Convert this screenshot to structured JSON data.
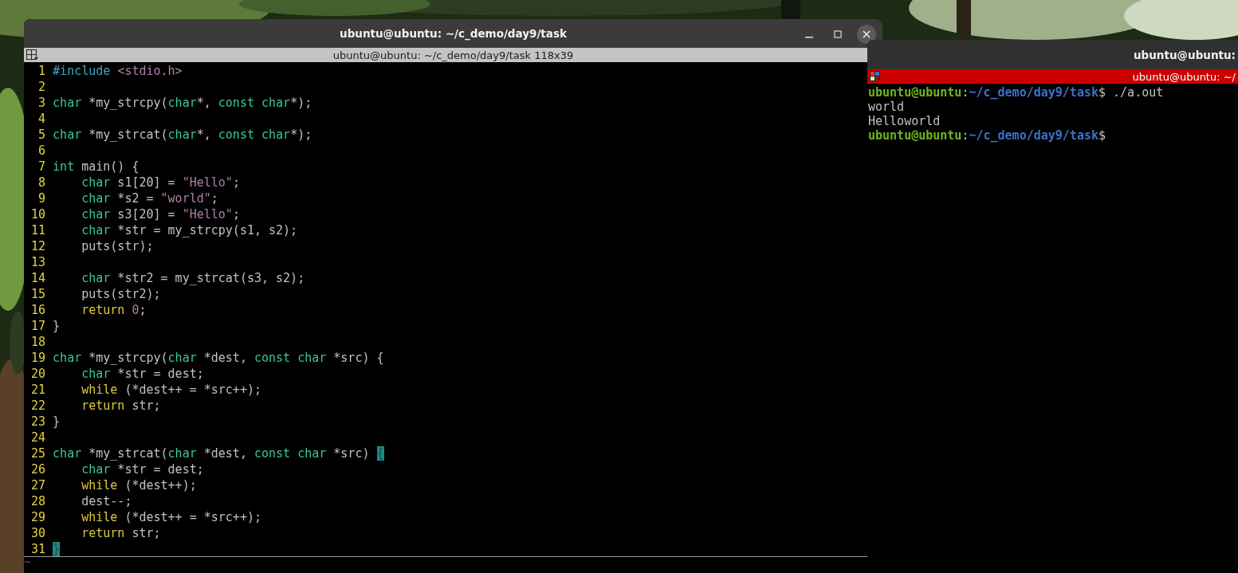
{
  "editor_window": {
    "title": "ubuntu@ubuntu: ~/c_demo/day9/task",
    "tab_title": "ubuntu@ubuntu: ~/c_demo/day9/task 118x39",
    "lines": [
      {
        "number": "1",
        "current": false,
        "tokens": [
          {
            "kind": "preproc",
            "text": "#include "
          },
          {
            "kind": "string",
            "text": "<stdio.h>"
          }
        ]
      },
      {
        "number": "2",
        "current": false
      },
      {
        "number": "3",
        "current": false,
        "tokens": [
          {
            "kind": "type",
            "text": "char"
          },
          {
            "kind": "plain",
            "text": " *my_strcpy("
          },
          {
            "kind": "type",
            "text": "char"
          },
          {
            "kind": "plain",
            "text": "*, "
          },
          {
            "kind": "type",
            "text": "const char"
          },
          {
            "kind": "plain",
            "text": "*);"
          }
        ]
      },
      {
        "number": "4",
        "current": false
      },
      {
        "number": "5",
        "current": false,
        "tokens": [
          {
            "kind": "type",
            "text": "char"
          },
          {
            "kind": "plain",
            "text": " *my_strcat("
          },
          {
            "kind": "type",
            "text": "char"
          },
          {
            "kind": "plain",
            "text": "*, "
          },
          {
            "kind": "type",
            "text": "const char"
          },
          {
            "kind": "plain",
            "text": "*);"
          }
        ]
      },
      {
        "number": "6",
        "current": false
      },
      {
        "number": "7",
        "current": false,
        "tokens": [
          {
            "kind": "type",
            "text": "int"
          },
          {
            "kind": "plain",
            "text": " main() {"
          }
        ]
      },
      {
        "number": "8",
        "current": false,
        "tokens": [
          {
            "kind": "type",
            "text": "    char"
          },
          {
            "kind": "plain",
            "text": " s1[20] = "
          },
          {
            "kind": "string",
            "text": "\"Hello\""
          },
          {
            "kind": "plain",
            "text": ";"
          }
        ]
      },
      {
        "number": "9",
        "current": false,
        "tokens": [
          {
            "kind": "type",
            "text": "    char"
          },
          {
            "kind": "plain",
            "text": " *s2 = "
          },
          {
            "kind": "string",
            "text": "\"world\""
          },
          {
            "kind": "plain",
            "text": ";"
          }
        ]
      },
      {
        "number": "10",
        "current": false,
        "tokens": [
          {
            "kind": "type",
            "text": "    char"
          },
          {
            "kind": "plain",
            "text": " s3[20] = "
          },
          {
            "kind": "string",
            "text": "\"Hello\""
          },
          {
            "kind": "plain",
            "text": ";"
          }
        ]
      },
      {
        "number": "11",
        "current": false,
        "tokens": [
          {
            "kind": "type",
            "text": "    char"
          },
          {
            "kind": "plain",
            "text": " *str = my_strcpy(s1, s2);"
          }
        ]
      },
      {
        "number": "12",
        "current": false,
        "tokens": [
          {
            "kind": "plain",
            "text": "    puts(str);"
          }
        ]
      },
      {
        "number": "13",
        "current": false
      },
      {
        "number": "14",
        "current": false,
        "tokens": [
          {
            "kind": "type",
            "text": "    char"
          },
          {
            "kind": "plain",
            "text": " *str2 = my_strcat(s3, s2);"
          }
        ]
      },
      {
        "number": "15",
        "current": false,
        "tokens": [
          {
            "kind": "plain",
            "text": "    puts(str2);"
          }
        ]
      },
      {
        "number": "16",
        "current": false,
        "tokens": [
          {
            "kind": "keyword",
            "text": "    return "
          },
          {
            "kind": "string",
            "text": "0"
          },
          {
            "kind": "plain",
            "text": ";"
          }
        ]
      },
      {
        "number": "17",
        "current": false,
        "tokens": [
          {
            "kind": "plain",
            "text": "}"
          }
        ]
      },
      {
        "number": "18",
        "current": false
      },
      {
        "number": "19",
        "current": false,
        "tokens": [
          {
            "kind": "type",
            "text": "char"
          },
          {
            "kind": "plain",
            "text": " *my_strcpy("
          },
          {
            "kind": "type",
            "text": "char"
          },
          {
            "kind": "plain",
            "text": " *dest, "
          },
          {
            "kind": "type",
            "text": "const char"
          },
          {
            "kind": "plain",
            "text": " *src) {"
          }
        ]
      },
      {
        "number": "20",
        "current": false,
        "tokens": [
          {
            "kind": "type",
            "text": "    char"
          },
          {
            "kind": "plain",
            "text": " *str = dest;"
          }
        ]
      },
      {
        "number": "21",
        "current": false,
        "tokens": [
          {
            "kind": "keyword",
            "text": "    while"
          },
          {
            "kind": "plain",
            "text": " (*dest++ = *src++);"
          }
        ]
      },
      {
        "number": "22",
        "current": false,
        "tokens": [
          {
            "kind": "keyword",
            "text": "    return"
          },
          {
            "kind": "plain",
            "text": " str;"
          }
        ]
      },
      {
        "number": "23",
        "current": false,
        "tokens": [
          {
            "kind": "plain",
            "text": "}"
          }
        ]
      },
      {
        "number": "24",
        "current": false
      },
      {
        "number": "25",
        "current": false,
        "tokens": [
          {
            "kind": "type",
            "text": "char"
          },
          {
            "kind": "plain",
            "text": " *my_strcat("
          },
          {
            "kind": "type",
            "text": "char"
          },
          {
            "kind": "plain",
            "text": " *dest, "
          },
          {
            "kind": "type",
            "text": "const char"
          },
          {
            "kind": "plain",
            "text": " *src) "
          },
          {
            "kind": "match",
            "text": "{"
          }
        ]
      },
      {
        "number": "26",
        "current": false,
        "tokens": [
          {
            "kind": "type",
            "text": "    char"
          },
          {
            "kind": "plain",
            "text": " *str = dest;"
          }
        ]
      },
      {
        "number": "27",
        "current": false,
        "tokens": [
          {
            "kind": "keyword",
            "text": "    while"
          },
          {
            "kind": "plain",
            "text": " (*dest++);"
          }
        ]
      },
      {
        "number": "28",
        "current": false,
        "tokens": [
          {
            "kind": "plain",
            "text": "    dest--;"
          }
        ]
      },
      {
        "number": "29",
        "current": false,
        "tokens": [
          {
            "kind": "keyword",
            "text": "    while"
          },
          {
            "kind": "plain",
            "text": " (*dest++ = *src++);"
          }
        ]
      },
      {
        "number": "30",
        "current": false,
        "tokens": [
          {
            "kind": "keyword",
            "text": "    return"
          },
          {
            "kind": "plain",
            "text": " str;"
          }
        ]
      },
      {
        "number": "31",
        "current": true,
        "tokens": [
          {
            "kind": "match",
            "text": "}"
          }
        ]
      }
    ],
    "filler": "~"
  },
  "terminal_window": {
    "title": "ubuntu@ubuntu:",
    "tab_title": "ubuntu@ubuntu: ~/",
    "lines": [
      {
        "segments": [
          {
            "kind": "user",
            "text": "ubuntu@ubuntu"
          },
          {
            "kind": "plain",
            "text": ":"
          },
          {
            "kind": "path",
            "text": "~/c_demo/day9/task"
          },
          {
            "kind": "plain",
            "text": "$ ./a.out"
          }
        ]
      },
      {
        "segments": [
          {
            "kind": "plain",
            "text": "world"
          }
        ]
      },
      {
        "segments": [
          {
            "kind": "plain",
            "text": "Helloworld"
          }
        ]
      },
      {
        "segments": [
          {
            "kind": "user",
            "text": "ubuntu@ubuntu"
          },
          {
            "kind": "plain",
            "text": ":"
          },
          {
            "kind": "path",
            "text": "~/c_demo/day9/task"
          },
          {
            "kind": "plain",
            "text": "$"
          }
        ]
      }
    ]
  }
}
